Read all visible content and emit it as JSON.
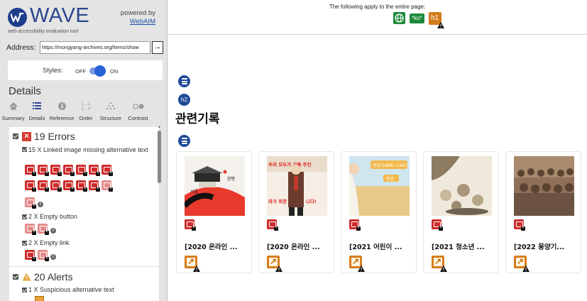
{
  "sidebar": {
    "logo_text": "WAVE",
    "tagline": "web accessibility evaluation tool",
    "powered_by": "powered by",
    "webaim_link": "WebAIM",
    "address_label": "Address:",
    "address_value": "https://mongyang-archives.org/items/show",
    "styles_label": "Styles:",
    "styles_off": "OFF",
    "styles_on": "ON",
    "styles_enabled": true,
    "details_heading": "Details",
    "tabs": [
      {
        "label": "Summary",
        "icon": "home-icon"
      },
      {
        "label": "Details",
        "icon": "list-icon",
        "active": true
      },
      {
        "label": "Reference",
        "icon": "info-icon"
      },
      {
        "label": "Order",
        "icon": "order-icon"
      },
      {
        "label": "Structure",
        "icon": "structure-icon"
      },
      {
        "label": "Contrast",
        "icon": "contrast-icon"
      }
    ],
    "errors": {
      "title": "19 Errors",
      "items": [
        {
          "label": "15 X Linked image missing alternative text"
        },
        {
          "label": "2 X Empty button"
        },
        {
          "label": "2 X Empty link"
        }
      ]
    },
    "alerts": {
      "title": "20 Alerts",
      "items": [
        {
          "label": "1 X Suspicious alternative text"
        }
      ]
    }
  },
  "main": {
    "entire_page_text": "The following apply to the entire page:",
    "lang_badge": "*ko*",
    "h1_badge": "h1",
    "h2_badge": "h2",
    "page_heading": "관련기록",
    "cards": [
      {
        "title": "[2020 온라인 ...",
        "image_text_1": "",
        "image_text_2": ""
      },
      {
        "title": "[2020 온라인 ...",
        "image_text_1": "우리 모두가 기록 주인",
        "image_text_2": "라가 위한 니다!"
      },
      {
        "title": "[2021 어린이 ...",
        "image_text_1": "몽양(1886~1947)",
        "image_text_2": "몽양"
      },
      {
        "title": "[2021 청소년 ...",
        "image_text_1": "",
        "image_text_2": ""
      },
      {
        "title": "[2022 몽양기...",
        "image_text_1": "",
        "image_text_2": ""
      }
    ],
    "card1_image_label": "서울",
    "card1_image_label2": "양평"
  },
  "colors": {
    "wave_blue": "#2a4591",
    "error_red": "#cf2b2b",
    "alert_orange": "#e8a23a",
    "structure_blue": "#1f4a99",
    "feature_green": "#1d8a3a"
  }
}
